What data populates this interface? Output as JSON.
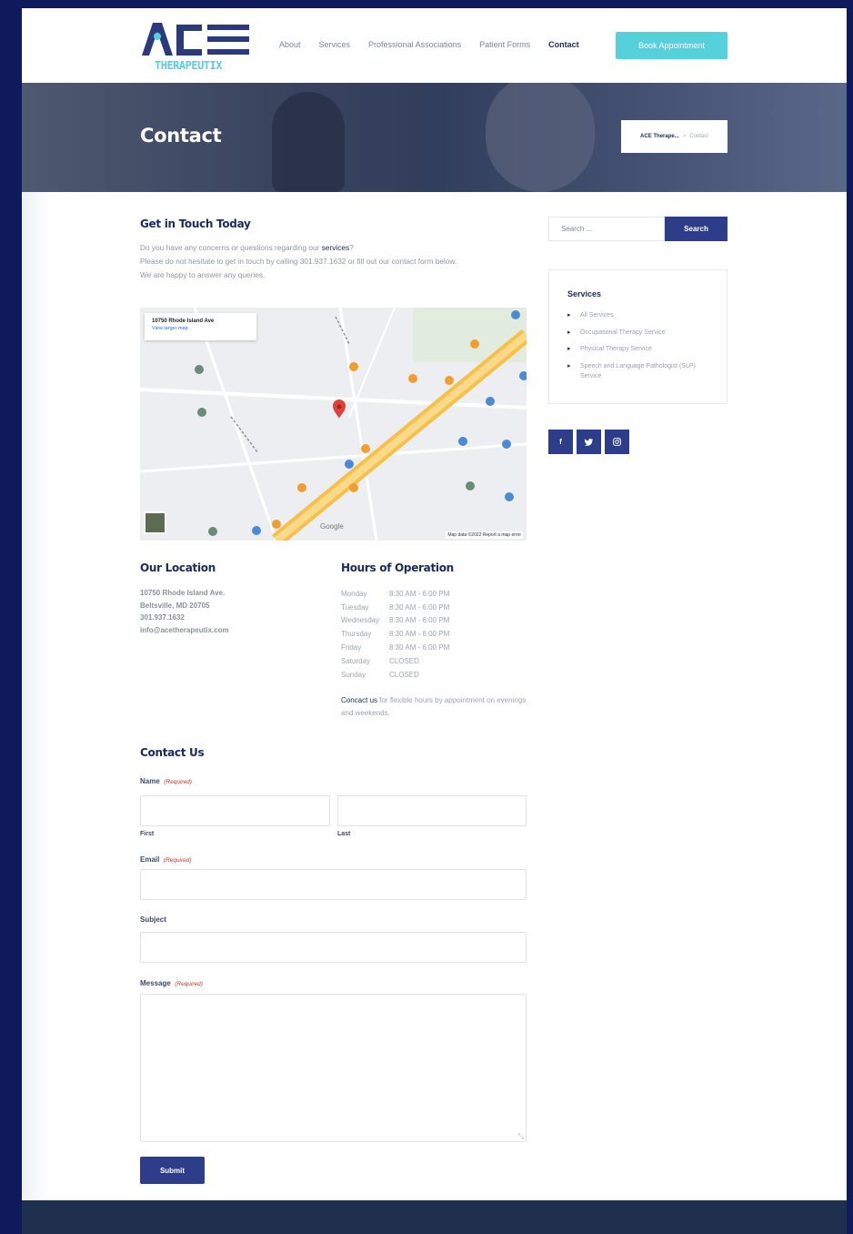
{
  "header": {
    "logo_main": "ACE",
    "logo_sub": "THERAPEUTIX",
    "nav": [
      "About",
      "Services",
      "Professional Associations",
      "Patient Forms",
      "Contact"
    ],
    "book_button": "Book Appointment"
  },
  "hero": {
    "title": "Contact",
    "breadcrumb_home": "ACE Therape...",
    "breadcrumb_sep": ">",
    "breadcrumb_current": "Contact"
  },
  "intro": {
    "heading": "Get in Touch Today",
    "line1_pre": "Do you have any concerns or questions regarding our ",
    "line1_link": "services",
    "line1_post": "?",
    "line2": "Please do not hesitate to get in touch by calling 301.937.1632 or fill out our contact form below.",
    "line3": "We are happy to answer any queries."
  },
  "map": {
    "place_title": "10750 Rhode Island Ave",
    "larger_map": "View larger map",
    "google": "Google",
    "attribution": "Map data ©2022  Report a map error"
  },
  "location": {
    "heading": "Our Location",
    "street": "10750 Rhode Island Ave.",
    "city": "Beltsville, MD 20705",
    "phone": "301.937.1632",
    "email": "info@acetherapeutix.com"
  },
  "hours": {
    "heading": "Hours of Operation",
    "rows": [
      {
        "day": "Monday",
        "time": "8:30 AM - 6:00 PM"
      },
      {
        "day": "Tuesday",
        "time": "8:30 AM - 6:00 PM"
      },
      {
        "day": "Wednesday",
        "time": "8:30 AM - 6:00 PM"
      },
      {
        "day": "Thursday",
        "time": "8:30 AM - 6:00 PM"
      },
      {
        "day": "Friday",
        "time": "8:30 AM - 6:00 PM"
      },
      {
        "day": "Saturday",
        "time": "CLOSED"
      },
      {
        "day": "Sunday",
        "time": "CLOSED"
      }
    ],
    "note_link": "Concact us",
    "note_text": " for flexible hours by appointment on evenings and weekends."
  },
  "form": {
    "heading": "Contact Us",
    "required": "(Required)",
    "name_label": "Name",
    "first_label": "First",
    "last_label": "Last",
    "email_label": "Email",
    "subject_label": "Subject",
    "message_label": "Message",
    "submit": "Submit"
  },
  "sidebar": {
    "search_placeholder": "Search ...",
    "search_button": "Search",
    "services_heading": "Services",
    "services": [
      "All Services",
      "Occupational Therapy Service",
      "Physical Therapy Service",
      "Speech and Language Pathologist (SLP) Service"
    ],
    "social": [
      "f",
      "t",
      "ig"
    ]
  },
  "colors": {
    "navy": "#1a2b5e",
    "accent": "#54d1db",
    "button": "#2e3d8a",
    "outer_bg": "#0e1a5c"
  }
}
